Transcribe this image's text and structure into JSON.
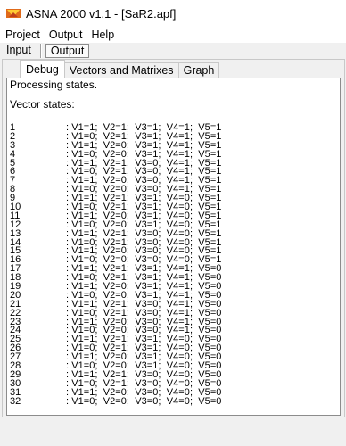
{
  "window": {
    "title": "ASNA 2000 v1.1 - [SaR2.apf]"
  },
  "menu": [
    "Project",
    "Output",
    "Help"
  ],
  "top_tabs": {
    "input": "Input",
    "output": "Output"
  },
  "tabs": [
    "Debug",
    "Vectors and Matrixes",
    "Graph"
  ],
  "log": {
    "line1": "Processing states.",
    "line2": "Vector states:"
  },
  "states": [
    {
      "n": "1",
      "v": ": V1=1;  V2=1;  V3=1;  V4=1;  V5=1"
    },
    {
      "n": "2",
      "v": ": V1=0;  V2=1;  V3=1;  V4=1;  V5=1"
    },
    {
      "n": "3",
      "v": ": V1=1;  V2=0;  V3=1;  V4=1;  V5=1"
    },
    {
      "n": "4",
      "v": ": V1=0;  V2=0;  V3=1;  V4=1;  V5=1"
    },
    {
      "n": "5",
      "v": ": V1=1;  V2=1;  V3=0;  V4=1;  V5=1"
    },
    {
      "n": "6",
      "v": ": V1=0;  V2=1;  V3=0;  V4=1;  V5=1"
    },
    {
      "n": "7",
      "v": ": V1=1;  V2=0;  V3=0;  V4=1;  V5=1"
    },
    {
      "n": "8",
      "v": ": V1=0;  V2=0;  V3=0;  V4=1;  V5=1"
    },
    {
      "n": "9",
      "v": ": V1=1;  V2=1;  V3=1;  V4=0;  V5=1"
    },
    {
      "n": "10",
      "v": ": V1=0;  V2=1;  V3=1;  V4=0;  V5=1"
    },
    {
      "n": "11",
      "v": ": V1=1;  V2=0;  V3=1;  V4=0;  V5=1"
    },
    {
      "n": "12",
      "v": ": V1=0;  V2=0;  V3=1;  V4=0;  V5=1"
    },
    {
      "n": "13",
      "v": ": V1=1;  V2=1;  V3=0;  V4=0;  V5=1"
    },
    {
      "n": "14",
      "v": ": V1=0;  V2=1;  V3=0;  V4=0;  V5=1"
    },
    {
      "n": "15",
      "v": ": V1=1;  V2=0;  V3=0;  V4=0;  V5=1"
    },
    {
      "n": "16",
      "v": ": V1=0;  V2=0;  V3=0;  V4=0;  V5=1"
    },
    {
      "n": "17",
      "v": ": V1=1;  V2=1;  V3=1;  V4=1;  V5=0"
    },
    {
      "n": "18",
      "v": ": V1=0;  V2=1;  V3=1;  V4=1;  V5=0"
    },
    {
      "n": "19",
      "v": ": V1=1;  V2=0;  V3=1;  V4=1;  V5=0"
    },
    {
      "n": "20",
      "v": ": V1=0;  V2=0;  V3=1;  V4=1;  V5=0"
    },
    {
      "n": "21",
      "v": ": V1=1;  V2=1;  V3=0;  V4=1;  V5=0"
    },
    {
      "n": "22",
      "v": ": V1=0;  V2=1;  V3=0;  V4=1;  V5=0"
    },
    {
      "n": "23",
      "v": ": V1=1;  V2=0;  V3=0;  V4=1;  V5=0"
    },
    {
      "n": "24",
      "v": ": V1=0;  V2=0;  V3=0;  V4=1;  V5=0"
    },
    {
      "n": "25",
      "v": ": V1=1;  V2=1;  V3=1;  V4=0;  V5=0"
    },
    {
      "n": "26",
      "v": ": V1=0;  V2=1;  V3=1;  V4=0;  V5=0"
    },
    {
      "n": "27",
      "v": ": V1=1;  V2=0;  V3=1;  V4=0;  V5=0"
    },
    {
      "n": "28",
      "v": ": V1=0;  V2=0;  V3=1;  V4=0;  V5=0"
    },
    {
      "n": "29",
      "v": ": V1=1;  V2=1;  V3=0;  V4=0;  V5=0"
    },
    {
      "n": "30",
      "v": ": V1=0;  V2=1;  V3=0;  V4=0;  V5=0"
    },
    {
      "n": "31",
      "v": ": V1=1;  V2=0;  V3=0;  V4=0;  V5=0"
    },
    {
      "n": "32",
      "v": ": V1=0;  V2=0;  V3=0;  V4=0;  V5=0"
    }
  ],
  "icons": {
    "app": "app-icon"
  },
  "colors": {
    "window_bg": "#f0f0f0",
    "content_bg": "#ffffff",
    "titlebar_bg": "#ffffff"
  }
}
